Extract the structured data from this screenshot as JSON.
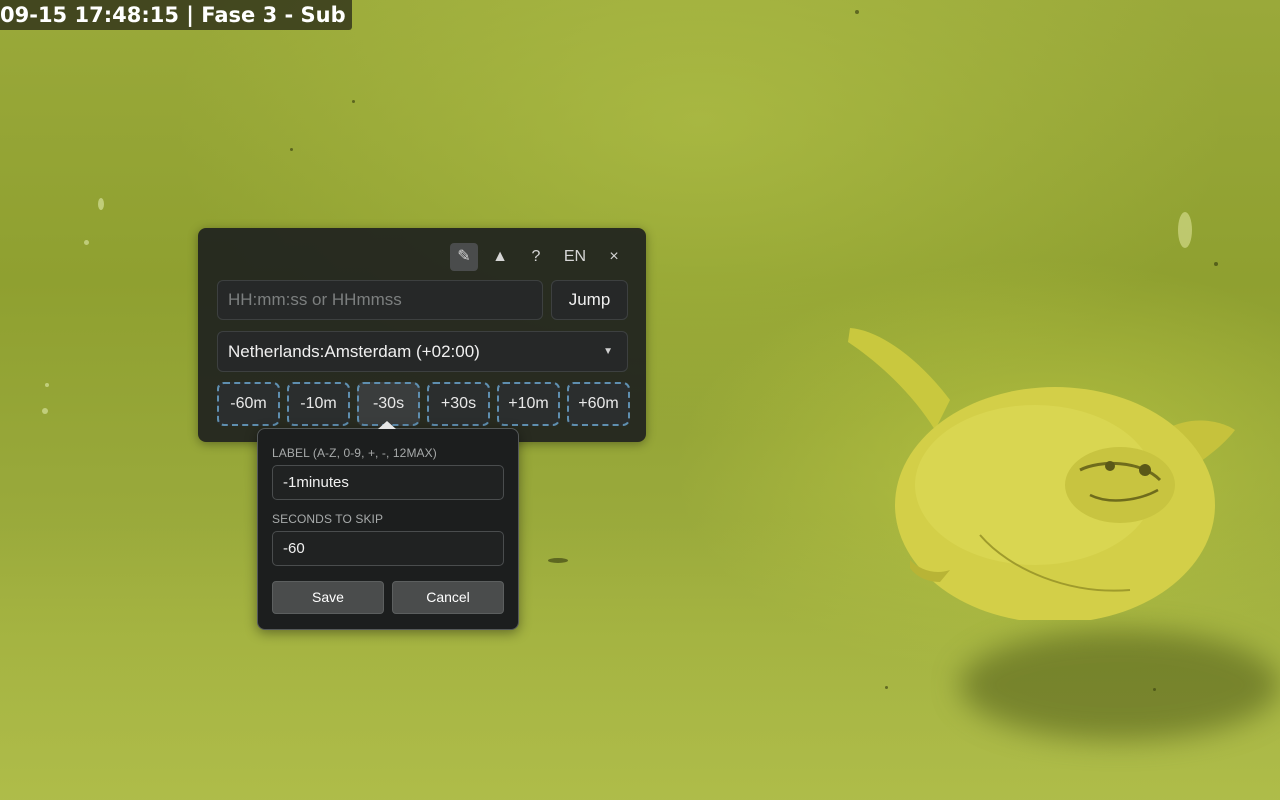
{
  "overlay": {
    "timestamp_text": "09-15  17:48:15  |  Fase 3 - Sub"
  },
  "toolbar": {
    "edit_glyph": "✎",
    "up_glyph": "▲",
    "help_label": "?",
    "language_label": "EN",
    "close_glyph": "×"
  },
  "jump": {
    "placeholder": "HH:mm:ss or HHmmss",
    "value": "",
    "button_label": "Jump"
  },
  "timezone": {
    "selected": "Netherlands:Amsterdam (+02:00)",
    "caret_glyph": "▼"
  },
  "skip_buttons": [
    {
      "label": "-60m"
    },
    {
      "label": "-10m"
    },
    {
      "label": "-30s"
    },
    {
      "label": "+30s"
    },
    {
      "label": "+10m"
    },
    {
      "label": "+60m"
    }
  ],
  "edit_popover": {
    "label_heading": "LABEL (A-Z, 0-9, +, -, 12MAX)",
    "label_value": "-1minutes",
    "seconds_heading": "SECONDS TO SKIP",
    "seconds_value": "-60",
    "save_label": "Save",
    "cancel_label": "Cancel"
  },
  "colors": {
    "water": "#8fa030",
    "panel_bg": "#1c1e1e",
    "dashed_border": "#5f8fb0",
    "seal": "#d7d24a"
  }
}
